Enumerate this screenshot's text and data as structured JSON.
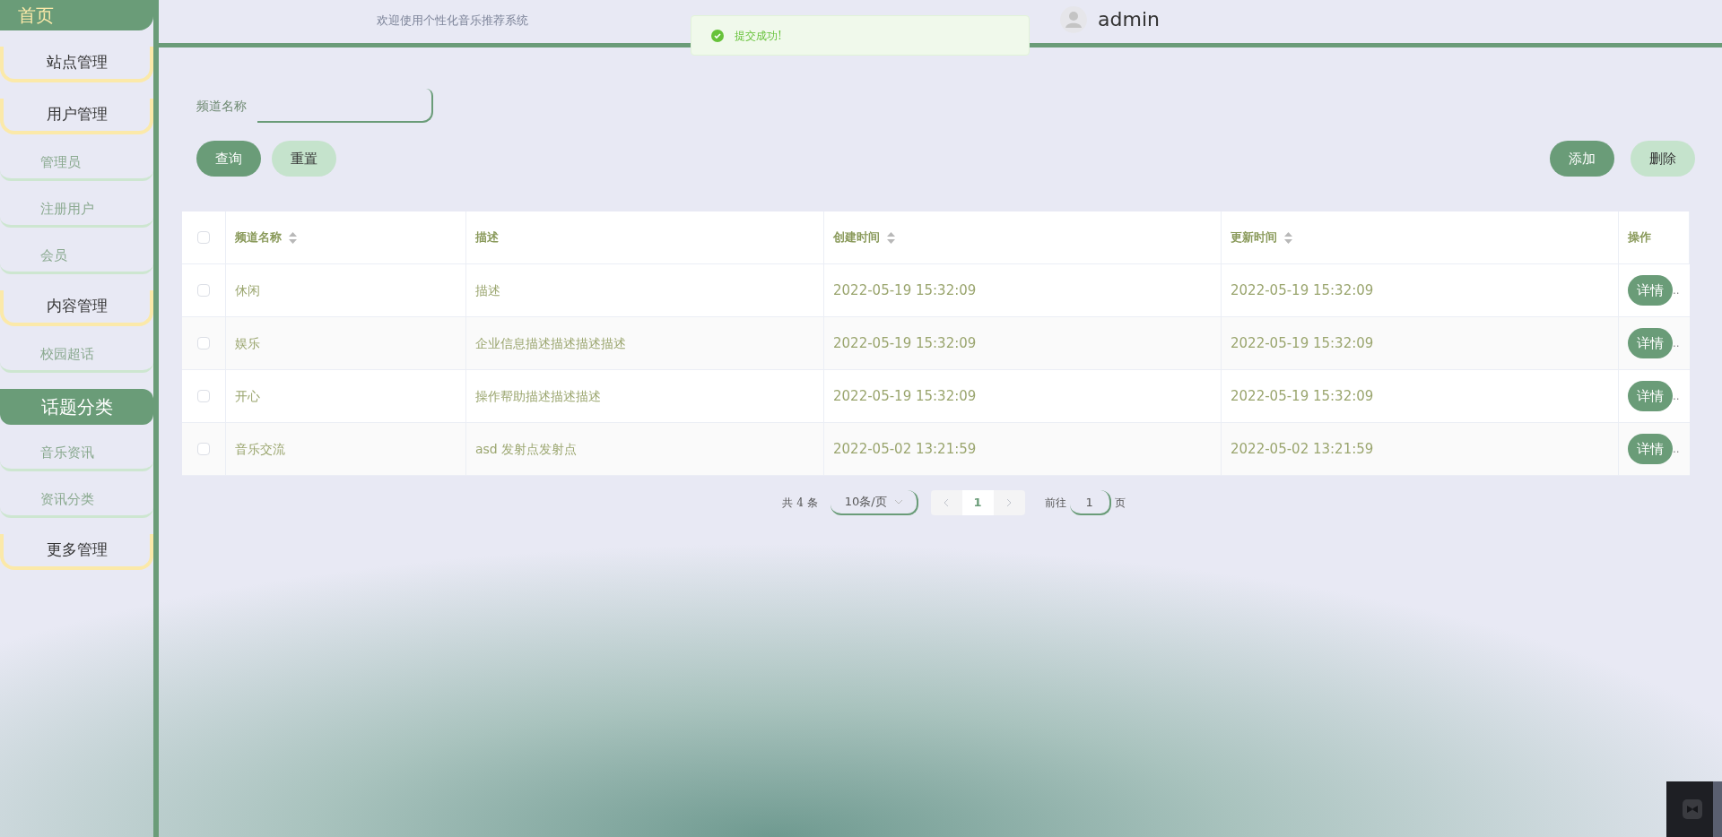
{
  "sidebar": {
    "menu": [
      {
        "kind": "home",
        "label": "首页",
        "selected": true
      },
      {
        "kind": "group",
        "label": "站点管理",
        "selected": false
      },
      {
        "kind": "group",
        "label": "用户管理",
        "selected": false
      },
      {
        "kind": "item",
        "label": "管理员",
        "selected": false
      },
      {
        "kind": "item",
        "label": "注册用户",
        "selected": false
      },
      {
        "kind": "item",
        "label": "会员",
        "selected": false
      },
      {
        "kind": "group",
        "label": "内容管理",
        "selected": false
      },
      {
        "kind": "item",
        "label": "校园超话",
        "selected": false
      },
      {
        "kind": "group",
        "label": "话题分类",
        "selected": true
      },
      {
        "kind": "item",
        "label": "音乐资讯",
        "selected": false
      },
      {
        "kind": "item",
        "label": "资讯分类",
        "selected": false
      },
      {
        "kind": "group",
        "label": "更多管理",
        "selected": false
      }
    ]
  },
  "header": {
    "welcome": "欢迎使用个性化音乐推荐系统",
    "user": "admin"
  },
  "toast": {
    "message": "提交成功!"
  },
  "search": {
    "label": "频道名称"
  },
  "buttons": {
    "left": [
      {
        "kind": "primary",
        "label": "查询"
      },
      {
        "kind": "secondary",
        "label": "重置"
      }
    ],
    "right": [
      {
        "kind": "primary",
        "label": "添加"
      },
      {
        "kind": "secondary",
        "label": "删除"
      }
    ]
  },
  "table": {
    "columns": [
      {
        "label": "频道名称",
        "sortable": true
      },
      {
        "label": "描述",
        "sortable": false
      },
      {
        "label": "创建时间",
        "sortable": true
      },
      {
        "label": "更新时间",
        "sortable": true
      },
      {
        "label": "操作",
        "sortable": false
      }
    ],
    "header_checked": false,
    "rows": [
      {
        "checked": false,
        "cells": [
          "休闲",
          "描述",
          "2022-05-19 15:32:09",
          "2022-05-19 15:32:09"
        ],
        "action": "详情",
        "overflow": ".."
      },
      {
        "checked": false,
        "cells": [
          "娱乐",
          "企业信息描述描述描述描述",
          "2022-05-19 15:32:09",
          "2022-05-19 15:32:09"
        ],
        "action": "详情",
        "overflow": ".."
      },
      {
        "checked": false,
        "cells": [
          "开心",
          "操作帮助描述描述描述",
          "2022-05-19 15:32:09",
          "2022-05-19 15:32:09"
        ],
        "action": "详情",
        "overflow": ".."
      },
      {
        "checked": false,
        "cells": [
          "音乐交流",
          "asd 发射点发射点",
          "2022-05-02 13:21:59",
          "2022-05-02 13:21:59"
        ],
        "action": "详情",
        "overflow": ".."
      }
    ]
  },
  "pagination": {
    "total": "共 4 条",
    "page_size": "10条/页",
    "pages": [
      {
        "label": "1",
        "selected": true
      }
    ],
    "goto_label": "前往",
    "goto_value": "1",
    "goto_suffix": "页"
  }
}
